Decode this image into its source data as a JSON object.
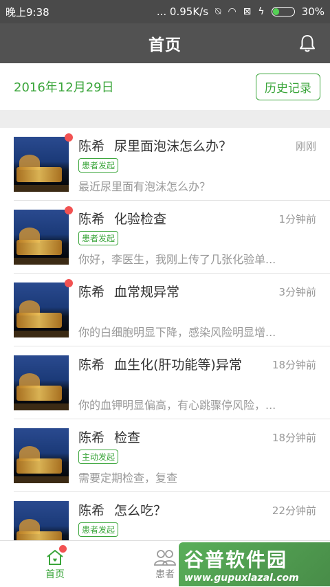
{
  "status_bar": {
    "time": "晚上9:38",
    "network": "... 0.95K/s",
    "battery": "30%",
    "battery_level": 0.3
  },
  "app_bar": {
    "title": "首页",
    "bell_icon": "bell-icon"
  },
  "date_bar": {
    "date": "2016年12月29日",
    "history_label": "历史记录"
  },
  "messages": [
    {
      "name": "陈希",
      "subject": "尿里面泡沫怎么办？",
      "time": "刚刚",
      "tag": "患者发起",
      "preview": "最近尿里面有泡沫怎么办？",
      "unread": true
    },
    {
      "name": "陈希",
      "subject": "化验检查",
      "time": "1分钟前",
      "tag": "患者发起",
      "preview": "你好，李医生，我刚上传了几张化验单...",
      "unread": true
    },
    {
      "name": "陈希",
      "subject": "血常规异常",
      "time": "3分钟前",
      "tag": "",
      "preview": "你的白细胞明显下降，感染风险明显增...",
      "unread": true
    },
    {
      "name": "陈希",
      "subject": "血生化(肝功能等)异常",
      "time": "18分钟前",
      "tag": "",
      "preview": "你的血钾明显偏高，有心跳骤停风险，...",
      "unread": false
    },
    {
      "name": "陈希",
      "subject": "检查",
      "time": "18分钟前",
      "tag": "主动发起",
      "preview": "需要定期检查，复查",
      "unread": false
    },
    {
      "name": "陈希",
      "subject": "怎么吃？",
      "time": "22分钟前",
      "tag": "患者发起",
      "preview": "",
      "unread": false
    }
  ],
  "tab_bar": {
    "tabs": [
      {
        "label": "首页",
        "icon": "home-icon"
      },
      {
        "label": "患者",
        "icon": "patients-icon"
      }
    ]
  },
  "watermark": {
    "line1": "谷普软件园",
    "line2": "www.gupuxlazal.com"
  },
  "colors": {
    "accent": "#3aa53a",
    "header": "#525252",
    "unread_dot": "#f25252"
  }
}
